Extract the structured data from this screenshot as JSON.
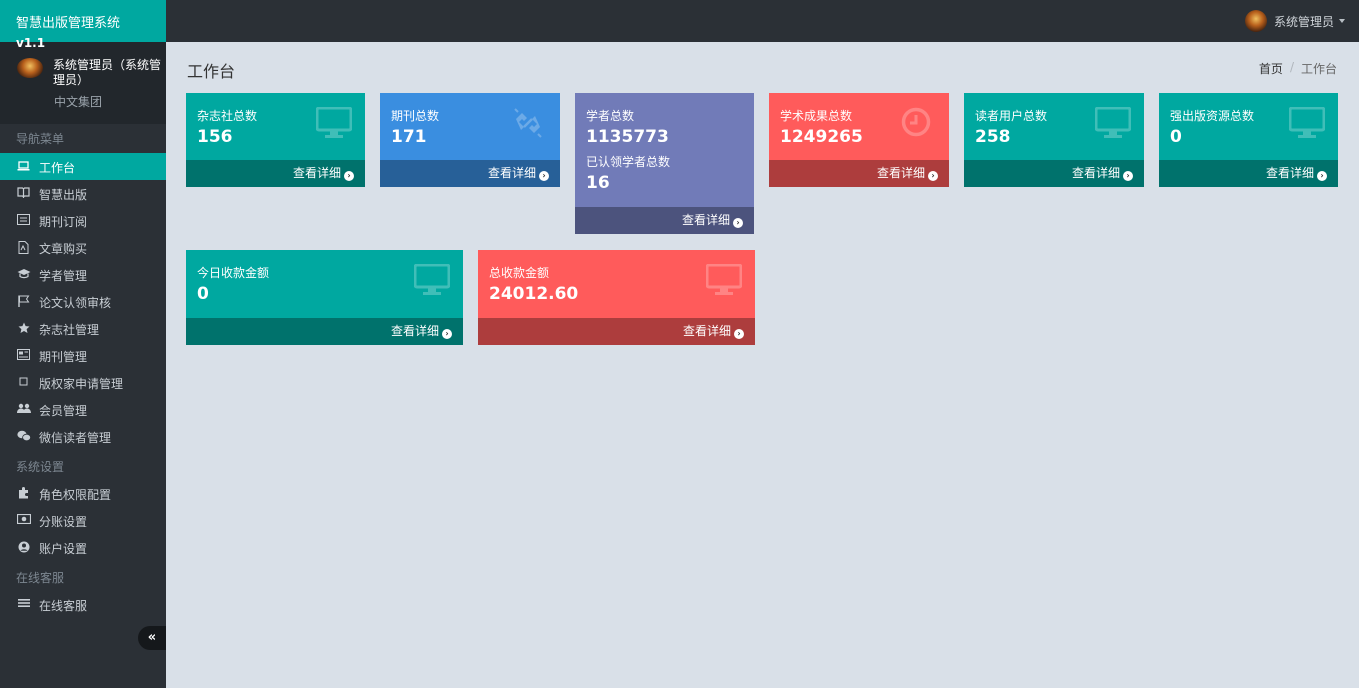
{
  "app": {
    "title": "智慧出版管理系统",
    "version": "v1.1"
  },
  "user": {
    "name": "系统管理员（系统管理员）",
    "org": "中文集团",
    "top_label": "系统管理员"
  },
  "colors": {
    "accent": "#00a8a0",
    "sidebar": "#2b3036",
    "content_bg": "#d9e0e8"
  },
  "nav": {
    "header_main": "导航菜单",
    "header_settings": "系统设置",
    "header_service": "在线客服",
    "items": [
      {
        "label": "工作台",
        "icon": "laptop-icon"
      },
      {
        "label": "智慧出版",
        "icon": "book-icon"
      },
      {
        "label": "期刊订阅",
        "icon": "list-icon"
      },
      {
        "label": "文章购买",
        "icon": "file-pdf-icon"
      },
      {
        "label": "学者管理",
        "icon": "graduation-cap-icon"
      },
      {
        "label": "论文认领审核",
        "icon": "flag-icon"
      },
      {
        "label": "杂志社管理",
        "icon": "star-icon"
      },
      {
        "label": "期刊管理",
        "icon": "newspaper-icon"
      },
      {
        "label": "版权家申请管理",
        "icon": "square-icon"
      },
      {
        "label": "会员管理",
        "icon": "users-icon"
      },
      {
        "label": "微信读者管理",
        "icon": "wechat-icon"
      }
    ],
    "settings_items": [
      {
        "label": "角色权限配置",
        "icon": "puzzle-icon"
      },
      {
        "label": "分账设置",
        "icon": "money-icon"
      },
      {
        "label": "账户设置",
        "icon": "user-circle-icon"
      }
    ],
    "service_items": [
      {
        "label": "在线客服",
        "icon": "bars-icon"
      }
    ],
    "collapse": "«"
  },
  "page": {
    "title": "工作台",
    "breadcrumb": [
      "首页",
      "工作台"
    ]
  },
  "cards": [
    {
      "label": "杂志社总数",
      "value": "156",
      "footer": "查看详细",
      "color": "#00a8a0"
    },
    {
      "label": "期刊总数",
      "value": "171",
      "footer": "查看详细",
      "color": "#3a8ee0"
    },
    {
      "label": "学者总数",
      "value": "1135773",
      "label2": "已认领学者总数",
      "value2": "16",
      "footer": "查看详细",
      "color": "#717bb8"
    },
    {
      "label": "学术成果总数",
      "value": "1249265",
      "footer": "查看详细",
      "color": "#ff5b5b"
    },
    {
      "label": "读者用户总数",
      "value": "258",
      "footer": "查看详细",
      "color": "#00a8a0"
    },
    {
      "label": "强出版资源总数",
      "value": "0",
      "footer": "查看详细",
      "color": "#00a8a0"
    },
    {
      "label": "今日收款金额",
      "value": "0",
      "footer": "查看详细",
      "color": "#00a8a0"
    },
    {
      "label": "总收款金额",
      "value": "24012.60",
      "footer": "查看详细",
      "color": "#ff5b5b"
    }
  ]
}
